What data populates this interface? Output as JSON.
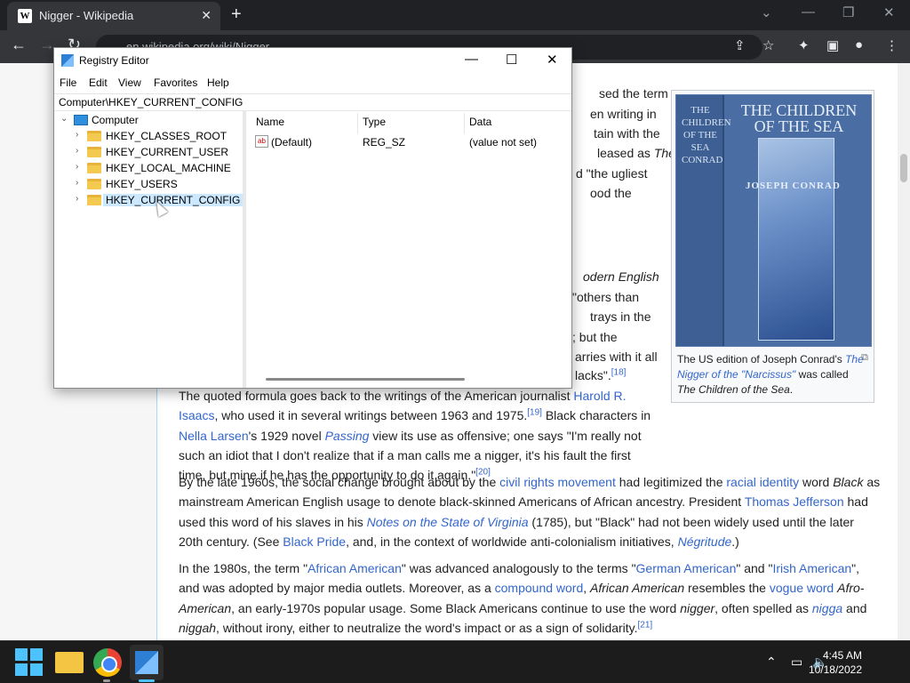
{
  "browser": {
    "tab_title": "Nigger - Wikipedia",
    "tab_favicon": "W",
    "url": "en.wikipedia.org/wiki/Nigger"
  },
  "article": {
    "frag_1": "sed the term",
    "frag_2": "en writing in",
    "frag_3": "tain with the",
    "frag_4": "leased as ",
    "frag_4i": "The",
    "frag_5": "d \"the ugliest",
    "frag_6": "ood the",
    "frag_7": "odern English",
    "frag_8": "\"others than",
    "frag_9": "trays in the",
    "frag_10": "; but the",
    "frag_11": "arries with it all",
    "frag_12": "lacks\".",
    "frag_12_ref": "[18]",
    "p1_a": "The quoted formula goes back to the writings of the American journalist ",
    "p1_link1": "Harold R. Isaacs",
    "p1_b": ", who used it in several writings between 1963 and 1975.",
    "p1_ref1": "[19]",
    "p1_c": " Black characters in ",
    "p1_link2": "Nella Larsen",
    "p1_d": "'s 1929 novel ",
    "p1_link3": "Passing",
    "p1_e": " view its use as offensive; one says \"I'm really not such an idiot that I don't realize that if a man calls me a nigger, it's his fault the first time, but mine if he has the opportunity to do it again.\"",
    "p1_ref2": "[20]",
    "p2_a": "By the late 1960s, the social change brought about by the ",
    "p2_link1": "civil rights movement",
    "p2_b": " had legitimized the ",
    "p2_link2": "racial identity",
    "p2_c": " word ",
    "p2_i1": "Black",
    "p2_d": " as mainstream American English usage to denote black-skinned Americans of African ancestry. President ",
    "p2_link3": "Thomas Jefferson",
    "p2_e": " had used this word of his slaves in his ",
    "p2_link4": "Notes on the State of Virginia",
    "p2_f": " (1785), but \"Black\" had not been widely used until the later 20th century. (See ",
    "p2_link5": "Black Pride",
    "p2_g": ", and, in the context of worldwide anti-colonialism initiatives, ",
    "p2_link6": "Négritude",
    "p2_h": ".)",
    "p3_a": "In the 1980s, the term \"",
    "p3_link1": "African American",
    "p3_b": "\" was advanced analogously to the terms \"",
    "p3_link2": "German American",
    "p3_c": "\" and \"",
    "p3_link3": "Irish American",
    "p3_d": "\", and was adopted by major media outlets. Moreover, as a ",
    "p3_link4": "compound word",
    "p3_e": ", ",
    "p3_i1": "African American",
    "p3_f": " resembles the ",
    "p3_link5": "vogue word",
    "p3_g": " ",
    "p3_i2": "Afro-American",
    "p3_h": ", an early-1970s popular usage. Some Black Americans continue to use the word ",
    "p3_i3": "nigger",
    "p3_i": ", often spelled as ",
    "p3_link6": "nigga",
    "p3_j": " and ",
    "p3_i4": "niggah",
    "p3_k": ", without irony, either to neutralize the word's impact or as a sign of solidarity.",
    "p3_ref": "[21]"
  },
  "infobox": {
    "cover_title": "THE CHILDREN OF THE SEA",
    "cover_spine": "THE CHILDREN OF THE SEA CONRAD",
    "cover_author": "JOSEPH CONRAD",
    "caption_a": "The US edition of Joseph Conrad's ",
    "caption_i1": "The Nigger of the \"Narcissus\"",
    "caption_b": " was called ",
    "caption_i2": "The Children of the Sea",
    "caption_c": "."
  },
  "regedit": {
    "title": "Registry Editor",
    "menu": [
      "File",
      "Edit",
      "View",
      "Favorites",
      "Help"
    ],
    "address": "Computer\\HKEY_CURRENT_CONFIG",
    "tree_root": "Computer",
    "tree_items": [
      "HKEY_CLASSES_ROOT",
      "HKEY_CURRENT_USER",
      "HKEY_LOCAL_MACHINE",
      "HKEY_USERS",
      "HKEY_CURRENT_CONFIG"
    ],
    "columns": [
      "Name",
      "Type",
      "Data"
    ],
    "row": {
      "name": "(Default)",
      "type": "REG_SZ",
      "data": "(value not set)"
    }
  },
  "taskbar": {
    "time": "4:45 AM",
    "date": "10/18/2022"
  }
}
